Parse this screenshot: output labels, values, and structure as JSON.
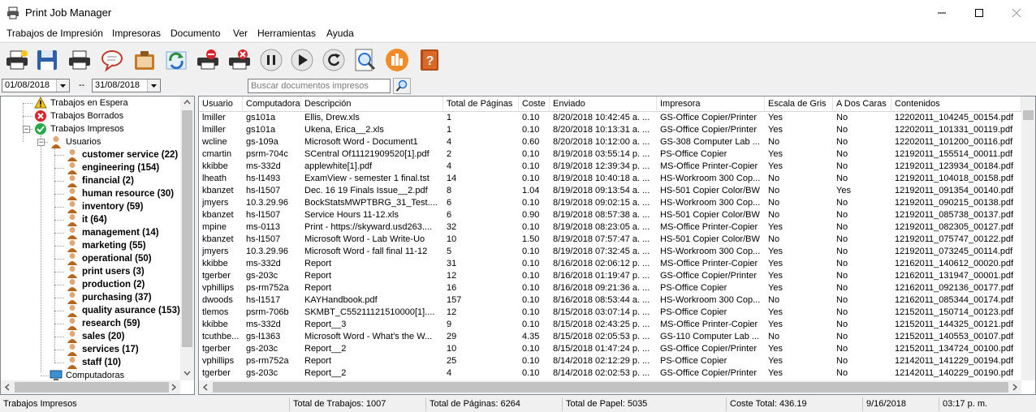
{
  "window": {
    "title": "Print Job Manager"
  },
  "menu": [
    "Trabajos de Impresión",
    "Impresoras",
    "Documento",
    "Ver",
    "Herramientas",
    "Ayuda"
  ],
  "toolbar": {
    "icons": [
      "printer-star-icon",
      "save-disk-icon",
      "printer-icon",
      "speech-bubble-icon",
      "clipboard-icon",
      "refresh-icon",
      "printer-stop-icon",
      "printer-delete-icon",
      "pause-icon",
      "play-icon",
      "restart-icon",
      "preview-magnifier-icon",
      "chart-icon",
      "help-book-icon"
    ]
  },
  "filter": {
    "date_from": "01/08/2018",
    "separator": "--",
    "date_to": "31/08/2018",
    "search_placeholder": "Buscar documentos impresos"
  },
  "tree": {
    "waiting": "Trabajos en Espera",
    "deleted": "Trabajos Borrados",
    "printed": "Trabajos Impresos",
    "users_node": "Usuarios",
    "groups": [
      "customer service (22)",
      "engineering (154)",
      "financial (2)",
      "human resource (30)",
      "inventory (59)",
      "it (64)",
      "management (14)",
      "marketing (55)",
      "operational (50)",
      "print users (3)",
      "production (2)",
      "purchasing (37)",
      "quality asurance (153)",
      "research (59)",
      "sales (20)",
      "services (17)",
      "staff (10)"
    ],
    "computers": "Computadoras"
  },
  "columns": [
    "Usuario",
    "Computadora",
    "Descripción",
    "Total de Páginas",
    "Coste",
    "Enviado",
    "Impresora",
    "Escala de Gris",
    "A Dos Caras",
    "Contenidos"
  ],
  "rows": [
    [
      "lmiller",
      "gs101a",
      "Ellis, Drew.xls",
      "1",
      "0.10",
      "8/20/2018 10:42:45 a. ...",
      "GS-Office Copier/Printer",
      "Yes",
      "No",
      "12202011_104245_00154.pdf"
    ],
    [
      "lmiller",
      "gs101a",
      "Ukena, Erica__2.xls",
      "1",
      "0.10",
      "8/20/2018 10:13:31 a. ...",
      "GS-Office Copier/Printer",
      "Yes",
      "No",
      "12202011_101331_00119.pdf"
    ],
    [
      "wcline",
      "gs-109a",
      "Microsoft Word - Document1",
      "4",
      "0.60",
      "8/20/2018 10:12:00 a. ...",
      "GS-308 Computer Lab ...",
      "No",
      "No",
      "12202011_101200_00116.pdf"
    ],
    [
      "cmartin",
      "psrm-704c",
      "SCentral Of11121909520[1].pdf",
      "2",
      "0.10",
      "8/19/2018 03:55:14 p. ...",
      "PS-Office Copier",
      "Yes",
      "No",
      "12192011_155514_00011.pdf"
    ],
    [
      "kkibbe",
      "ms-332d",
      "applewhite[1].pdf",
      "4",
      "0.10",
      "8/19/2018 12:39:34 p. ...",
      "MS-Office Printer-Copier",
      "Yes",
      "No",
      "12192011_123934_00184.pdf"
    ],
    [
      "lheath",
      "hs-l1493",
      "ExamView - semester 1 final.tst",
      "14",
      "0.10",
      "8/19/2018 10:40:18 a. ...",
      "HS-Workroom 300 Cop...",
      "No",
      "No",
      "12192011_104018_00158.pdf"
    ],
    [
      "kbanzet",
      "hs-l1507",
      "Dec. 16  19 Finals Issue__2.pdf",
      "8",
      "1.04",
      "8/19/2018 09:13:54 a. ...",
      "HS-501 Copier Color/BW",
      "No",
      "Yes",
      "12192011_091354_00140.pdf"
    ],
    [
      "jmyers",
      "10.3.29.96",
      "BockStatsMWPTBRG_31_Test....",
      "6",
      "0.10",
      "8/19/2018 09:02:15 a. ...",
      "HS-Workroom 300 Cop...",
      "No",
      "No",
      "12192011_090215_00138.pdf"
    ],
    [
      "kbanzet",
      "hs-l1507",
      "Service Hours 11-12.xls",
      "6",
      "0.90",
      "8/19/2018 08:57:38 a. ...",
      "HS-501 Copier Color/BW",
      "No",
      "No",
      "12192011_085738_00137.pdf"
    ],
    [
      "mpine",
      "ms-0113",
      "Print - https://skyward.usd263....",
      "32",
      "0.10",
      "8/19/2018 08:23:05 a. ...",
      "MS-Office Printer-Copier",
      "Yes",
      "No",
      "12192011_082305_00127.pdf"
    ],
    [
      "kbanzet",
      "hs-l1507",
      "Microsoft Word - Lab Write-Uo",
      "10",
      "1.50",
      "8/19/2018 07:57:47 a. ...",
      "HS-501 Copier Color/BW",
      "No",
      "No",
      "12192011_075747_00122.pdf"
    ],
    [
      "jmyers",
      "10.3.29.96",
      "Microsoft Word - fall final 11-12",
      "5",
      "0.10",
      "8/19/2018 07:32:45 a. ...",
      "HS-Workroom 300 Cop...",
      "Yes",
      "No",
      "12192011_073245_00114.pdf"
    ],
    [
      "kkibbe",
      "ms-332d",
      "Report",
      "31",
      "0.10",
      "8/16/2018 02:06:12 p. ...",
      "MS-Office Printer-Copier",
      "Yes",
      "No",
      "12162011_140612_00020.pdf"
    ],
    [
      "tgerber",
      "gs-203c",
      "Report",
      "12",
      "0.10",
      "8/16/2018 01:19:47 p. ...",
      "GS-Office Copier/Printer",
      "Yes",
      "No",
      "12162011_131947_00001.pdf"
    ],
    [
      "vphillips",
      "ps-rm752a",
      "Report",
      "16",
      "0.10",
      "8/16/2018 09:21:36 a. ...",
      "PS-Office Copier",
      "Yes",
      "No",
      "12162011_092136_00177.pdf"
    ],
    [
      "dwoods",
      "hs-l1517",
      "KAYHandbook.pdf",
      "157",
      "0.10",
      "8/16/2018 08:53:44 a. ...",
      "HS-Workroom 300 Cop...",
      "No",
      "No",
      "12162011_085344_00174.pdf"
    ],
    [
      "tlemos",
      "psrm-706b",
      "SKMBT_C55211121510000[1]....",
      "12",
      "0.10",
      "8/15/2018 03:07:14 p. ...",
      "PS-Office Copier",
      "Yes",
      "No",
      "12152011_150714_00123.pdf"
    ],
    [
      "kkibbe",
      "ms-332d",
      "Report__3",
      "9",
      "0.10",
      "8/15/2018 02:43:25 p. ...",
      "MS-Office Printer-Copier",
      "Yes",
      "No",
      "12152011_144325_00121.pdf"
    ],
    [
      "tcuthbe...",
      "gs-l1363",
      "Microsoft Word - What's the W...",
      "29",
      "4.35",
      "8/15/2018 02:05:53 p. ...",
      "GS-110 Computer Lab ...",
      "No",
      "No",
      "12152011_140553_00107.pdf"
    ],
    [
      "tgerber",
      "gs-203c",
      "Report__2",
      "10",
      "0.10",
      "8/15/2018 01:47:24 p. ...",
      "GS-Office Copier/Printer",
      "Yes",
      "No",
      "12152011_134724_00100.pdf"
    ],
    [
      "vphillips",
      "ps-rm752a",
      "Report",
      "25",
      "0.10",
      "8/14/2018 02:12:29 p. ...",
      "PS-Office Copier",
      "Yes",
      "No",
      "12142011_141229_00194.pdf"
    ],
    [
      "tgerber",
      "gs-203c",
      "Report__2",
      "4",
      "0.10",
      "8/14/2018 02:02:53 p. ...",
      "GS-Office Copier/Printer",
      "Yes",
      "No",
      "12142011_140229_00190.pdf"
    ]
  ],
  "status": {
    "section": "Trabajos Impresos",
    "total_jobs": "Total de Trabajos: 1007",
    "total_pages": "Total de Páginas: 6264",
    "total_paper": "Total de Papel: 5035",
    "total_cost": "Coste Total: 436.19",
    "date": "9/16/2018",
    "time": "03:17 p. m."
  }
}
